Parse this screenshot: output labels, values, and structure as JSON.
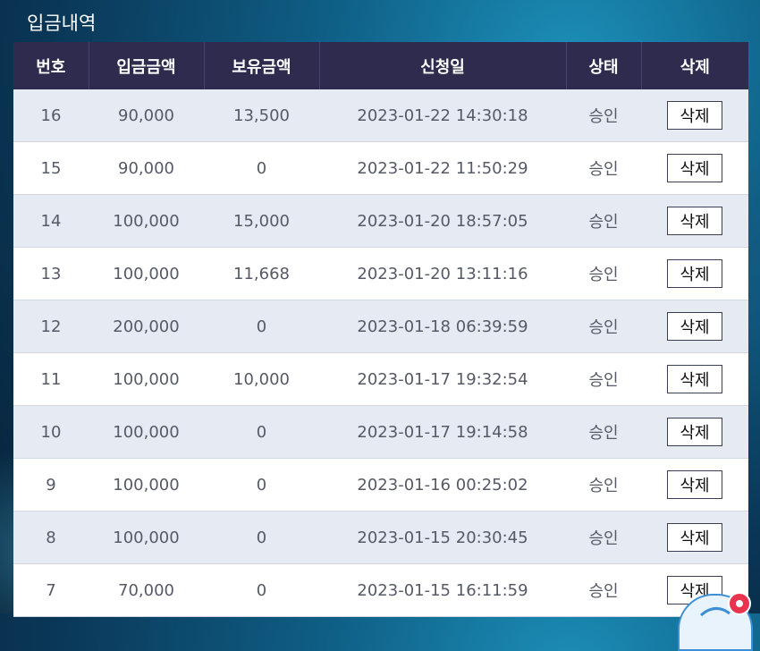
{
  "page": {
    "title": "입금내역"
  },
  "table": {
    "headers": [
      "번호",
      "입금금액",
      "보유금액",
      "신청일",
      "상태",
      "삭제"
    ],
    "rows": [
      {
        "no": "16",
        "deposit": "90,000",
        "held": "13,500",
        "date": "2023-01-22 14:30:18",
        "status": "승인",
        "delete_label": "삭제"
      },
      {
        "no": "15",
        "deposit": "90,000",
        "held": "0",
        "date": "2023-01-22 11:50:29",
        "status": "승인",
        "delete_label": "삭제"
      },
      {
        "no": "14",
        "deposit": "100,000",
        "held": "15,000",
        "date": "2023-01-20 18:57:05",
        "status": "승인",
        "delete_label": "삭제"
      },
      {
        "no": "13",
        "deposit": "100,000",
        "held": "11,668",
        "date": "2023-01-20 13:11:16",
        "status": "승인",
        "delete_label": "삭제"
      },
      {
        "no": "12",
        "deposit": "200,000",
        "held": "0",
        "date": "2023-01-18 06:39:59",
        "status": "승인",
        "delete_label": "삭제"
      },
      {
        "no": "11",
        "deposit": "100,000",
        "held": "10,000",
        "date": "2023-01-17 19:32:54",
        "status": "승인",
        "delete_label": "삭제"
      },
      {
        "no": "10",
        "deposit": "100,000",
        "held": "0",
        "date": "2023-01-17 19:14:58",
        "status": "승인",
        "delete_label": "삭제"
      },
      {
        "no": "9",
        "deposit": "100,000",
        "held": "0",
        "date": "2023-01-16 00:25:02",
        "status": "승인",
        "delete_label": "삭제"
      },
      {
        "no": "8",
        "deposit": "100,000",
        "held": "0",
        "date": "2023-01-15 20:30:45",
        "status": "승인",
        "delete_label": "삭제"
      },
      {
        "no": "7",
        "deposit": "70,000",
        "held": "0",
        "date": "2023-01-15 16:11:59",
        "status": "승인",
        "delete_label": "삭제"
      }
    ]
  },
  "icons": {
    "float_widget": "chat-bubble-icon",
    "badge": "notification-dot-icon"
  },
  "colors": {
    "header_bg": "#2e2b4e",
    "row_odd": "#e6eaf2",
    "row_even": "#ffffff",
    "text": "#555a66",
    "badge": "#e8344e"
  }
}
